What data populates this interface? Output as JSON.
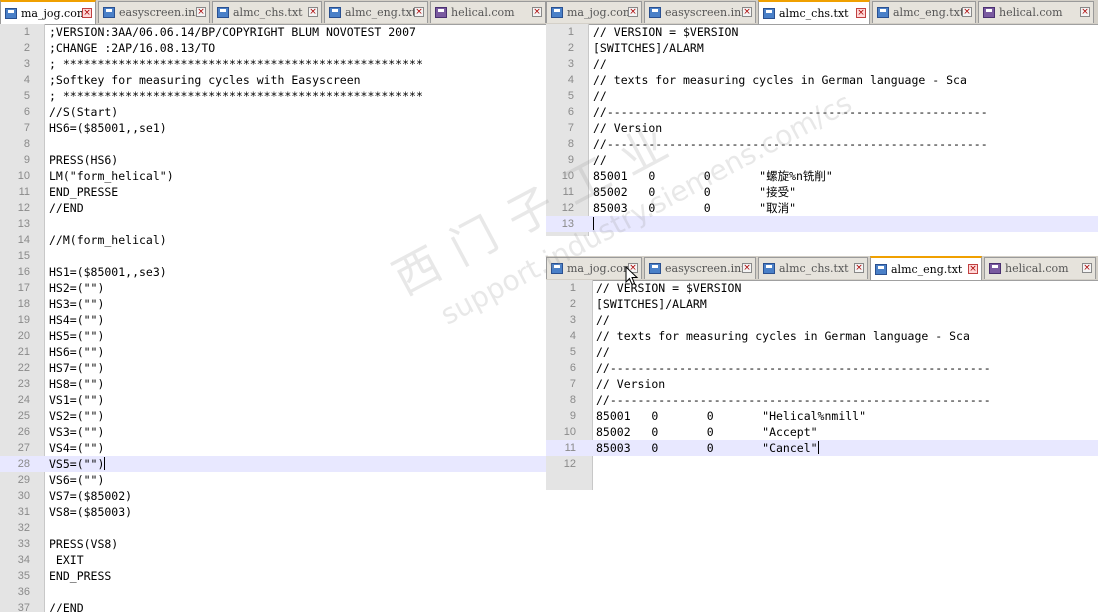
{
  "left_editor": {
    "tabs": [
      {
        "label": "ma_jog.com",
        "active": true,
        "icon": "file-icon"
      },
      {
        "label": "easyscreen.ini",
        "active": false,
        "icon": "file-icon"
      },
      {
        "label": "almc_chs.txt",
        "active": false,
        "icon": "file-icon"
      },
      {
        "label": "almc_eng.txt",
        "active": false,
        "icon": "file-icon"
      },
      {
        "label": "helical.com",
        "active": false,
        "icon": "purple-file-icon"
      }
    ],
    "lines": [
      {
        "n": "1",
        "t": ";VERSION:3AA/06.06.14/BP/COPYRIGHT BLUM NOVOTEST 2007"
      },
      {
        "n": "2",
        "t": ";CHANGE :2AP/16.08.13/TO"
      },
      {
        "n": "3",
        "t": "; ****************************************************"
      },
      {
        "n": "4",
        "t": ";Softkey for measuring cycles with Easyscreen"
      },
      {
        "n": "5",
        "t": "; ****************************************************"
      },
      {
        "n": "6",
        "t": "//S(Start)"
      },
      {
        "n": "7",
        "t": "HS6=($85001,,se1)"
      },
      {
        "n": "8",
        "t": ""
      },
      {
        "n": "9",
        "t": "PRESS(HS6)"
      },
      {
        "n": "10",
        "t": "LM(\"form_helical\")"
      },
      {
        "n": "11",
        "t": "END_PRESSE"
      },
      {
        "n": "12",
        "t": "//END"
      },
      {
        "n": "13",
        "t": ""
      },
      {
        "n": "14",
        "t": "//M(form_helical)"
      },
      {
        "n": "15",
        "t": ""
      },
      {
        "n": "16",
        "t": "HS1=($85001,,se3)"
      },
      {
        "n": "17",
        "t": "HS2=(\"\")"
      },
      {
        "n": "18",
        "t": "HS3=(\"\")"
      },
      {
        "n": "19",
        "t": "HS4=(\"\")"
      },
      {
        "n": "20",
        "t": "HS5=(\"\")"
      },
      {
        "n": "21",
        "t": "HS6=(\"\")"
      },
      {
        "n": "22",
        "t": "HS7=(\"\")"
      },
      {
        "n": "23",
        "t": "HS8=(\"\")"
      },
      {
        "n": "24",
        "t": "VS1=(\"\")"
      },
      {
        "n": "25",
        "t": "VS2=(\"\")"
      },
      {
        "n": "26",
        "t": "VS3=(\"\")"
      },
      {
        "n": "27",
        "t": "VS4=(\"\")"
      },
      {
        "n": "28",
        "t": "VS5=(\"\")",
        "current": true
      },
      {
        "n": "29",
        "t": "VS6=(\"\")"
      },
      {
        "n": "30",
        "t": "VS7=($85002)"
      },
      {
        "n": "31",
        "t": "VS8=($85003)"
      },
      {
        "n": "32",
        "t": ""
      },
      {
        "n": "33",
        "t": "PRESS(VS8)"
      },
      {
        "n": "34",
        "t": " EXIT"
      },
      {
        "n": "35",
        "t": "END_PRESS"
      },
      {
        "n": "36",
        "t": ""
      },
      {
        "n": "37",
        "t": "//END"
      }
    ]
  },
  "top_right_editor": {
    "tabs": [
      {
        "label": "ma_jog.com",
        "active": false,
        "icon": "file-icon"
      },
      {
        "label": "easyscreen.ini",
        "active": false,
        "icon": "file-icon"
      },
      {
        "label": "almc_chs.txt",
        "active": true,
        "icon": "file-icon"
      },
      {
        "label": "almc_eng.txt",
        "active": false,
        "icon": "file-icon"
      },
      {
        "label": "helical.com",
        "active": false,
        "icon": "purple-file-icon"
      }
    ],
    "lines": [
      {
        "n": "1",
        "t": "// VERSION = $VERSION"
      },
      {
        "n": "2",
        "t": "[SWITCHES]/ALARM"
      },
      {
        "n": "3",
        "t": "//"
      },
      {
        "n": "4",
        "t": "// texts for measuring cycles in German language - Sca"
      },
      {
        "n": "5",
        "t": "//"
      },
      {
        "n": "6",
        "t": "//-------------------------------------------------------"
      },
      {
        "n": "7",
        "t": "// Version"
      },
      {
        "n": "8",
        "t": "//-------------------------------------------------------"
      },
      {
        "n": "9",
        "t": "//"
      },
      {
        "n": "10",
        "t": "85001   0       0       \"螺旋%n铣削\""
      },
      {
        "n": "11",
        "t": "85002   0       0       \"接受\""
      },
      {
        "n": "12",
        "t": "85003   0       0       \"取消\""
      },
      {
        "n": "13",
        "t": "",
        "current": true
      }
    ]
  },
  "bottom_right_editor": {
    "tabs": [
      {
        "label": "ma_jog.com",
        "active": false,
        "icon": "file-icon"
      },
      {
        "label": "easyscreen.ini",
        "active": false,
        "icon": "file-icon"
      },
      {
        "label": "almc_chs.txt",
        "active": false,
        "icon": "file-icon"
      },
      {
        "label": "almc_eng.txt",
        "active": true,
        "icon": "file-icon"
      },
      {
        "label": "helical.com",
        "active": false,
        "icon": "purple-file-icon"
      }
    ],
    "lines": [
      {
        "n": "1",
        "t": "// VERSION = $VERSION"
      },
      {
        "n": "2",
        "t": "[SWITCHES]/ALARM"
      },
      {
        "n": "3",
        "t": "//"
      },
      {
        "n": "4",
        "t": "// texts for measuring cycles in German language - Sca"
      },
      {
        "n": "5",
        "t": "//"
      },
      {
        "n": "6",
        "t": "//-------------------------------------------------------"
      },
      {
        "n": "7",
        "t": "// Version"
      },
      {
        "n": "8",
        "t": "//-------------------------------------------------------"
      },
      {
        "n": "9",
        "t": "85001   0       0       \"Helical%nmill\""
      },
      {
        "n": "10",
        "t": "85002   0       0       \"Accept\""
      },
      {
        "n": "11",
        "t": "85003   0       0       \"Cancel\"",
        "current": true
      },
      {
        "n": "12",
        "t": ""
      }
    ]
  },
  "watermark": {
    "line1": "西门子工业",
    "line2": "support.industry.siemens.com/cs"
  },
  "colors": {
    "current_line": "#e8e8ff",
    "active_tab_accent": "#f0a000",
    "gutter": "#e4e4e4"
  }
}
